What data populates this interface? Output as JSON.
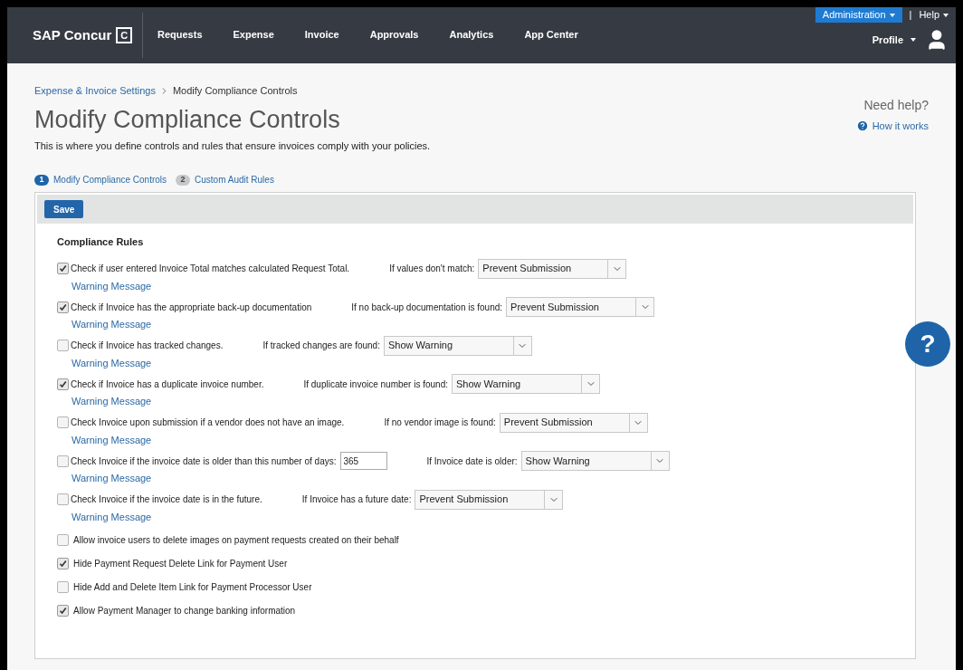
{
  "nav": {
    "logo": "SAP Concur",
    "logo_mark": "C",
    "items": [
      "Requests",
      "Expense",
      "Invoice",
      "Approvals",
      "Analytics",
      "App Center"
    ],
    "admin": "Administration",
    "separator": "|",
    "help": "Help",
    "profile": "Profile"
  },
  "breadcrumb": [
    {
      "label": "Expense & Invoice Settings",
      "kind": "link"
    },
    {
      "label": "Modify Compliance Controls",
      "kind": "current"
    }
  ],
  "title": "Modify Compliance Controls",
  "subtitle": "This is where you define controls and rules that ensure invoices comply with your policies.",
  "help": {
    "heading": "Need help?",
    "link": "How it works",
    "float": "?"
  },
  "steps": [
    {
      "number": "1",
      "label": "Modify Compliance Controls",
      "selected": true
    },
    {
      "number": "2",
      "label": "Custom Audit Rules",
      "selected": false
    }
  ],
  "save": "Save",
  "section_title": "Compliance Rules",
  "rules": [
    {
      "kind": "rule",
      "label": "Check if user entered Invoice Total matches calculated Request Total.",
      "checked": true,
      "warning": "Warning Message",
      "condition": "If values don't match:",
      "action": "Prevent Submission"
    },
    {
      "kind": "rule",
      "label": "Check if Invoice has the appropriate back-up documentation",
      "checked": true,
      "warning": "Warning Message",
      "condition": "If no back-up documentation is found:",
      "action": "Prevent Submission"
    },
    {
      "kind": "rule",
      "label": "Check if Invoice has tracked changes.",
      "checked": false,
      "warning": "Warning Message",
      "condition": "If tracked changes are found:",
      "action": "Show Warning"
    },
    {
      "kind": "rule",
      "label": "Check if Invoice has a duplicate invoice number.",
      "checked": true,
      "warning": "Warning Message",
      "condition": "If duplicate invoice number is found:",
      "action": "Show Warning"
    },
    {
      "kind": "rule",
      "label": "Check Invoice upon submission if a vendor does not have an image.",
      "checked": false,
      "warning": "Warning Message",
      "condition": "If no vendor image is found:",
      "action": "Prevent Submission"
    },
    {
      "kind": "rule",
      "label": "Check Invoice if the invoice date is older than this number of days:",
      "checked": false,
      "days": "365",
      "warning": "Warning Message",
      "condition": "If Invoice date is older:",
      "action": "Show Warning"
    },
    {
      "kind": "rule",
      "label": "Check Invoice if the invoice date is in the future.",
      "checked": false,
      "warning": "Warning Message",
      "condition": "If Invoice has a future date:",
      "action": "Prevent Submission"
    },
    {
      "kind": "option",
      "label": "Allow invoice users to delete images on payment requests created on their behalf",
      "checked": false
    },
    {
      "kind": "option",
      "label": "Hide Payment Request Delete Link for Payment User",
      "checked": true
    },
    {
      "kind": "option",
      "label": "Hide Add and Delete Item Link for Payment Processor User",
      "checked": false
    },
    {
      "kind": "option",
      "label": "Allow Payment Manager to change banking information",
      "checked": true
    }
  ]
}
